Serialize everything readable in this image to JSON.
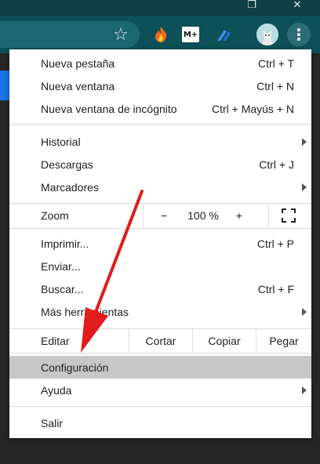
{
  "window": {
    "restore_glyph": "❐",
    "close_glyph": "✕"
  },
  "toolbar": {
    "star_glyph": "☆",
    "extensions": [
      "flame-extension",
      "movistar-plus-extension",
      "blue-arrow-extension"
    ],
    "movistar_text": "M+",
    "menu_glyph": "⋮",
    "colors": {
      "toolbar": "#0d5058",
      "titlebar": "#123f44",
      "omnibox": "#1d6770"
    }
  },
  "menu": {
    "group1": [
      {
        "label": "Nueva pestaña",
        "shortcut": "Ctrl + T"
      },
      {
        "label": "Nueva ventana",
        "shortcut": "Ctrl + N"
      },
      {
        "label": "Nueva ventana de incógnito",
        "shortcut": "Ctrl + Mayús + N"
      }
    ],
    "group2": [
      {
        "label": "Historial",
        "shortcut": "",
        "has_submenu": true
      },
      {
        "label": "Descargas",
        "shortcut": "Ctrl + J"
      },
      {
        "label": "Marcadores",
        "shortcut": "",
        "has_submenu": true
      }
    ],
    "zoom": {
      "label": "Zoom",
      "minus": "−",
      "value": "100 %",
      "plus": "+",
      "fullscreen_icon": "fullscreen-icon"
    },
    "group3": [
      {
        "label": "Imprimir...",
        "shortcut": "Ctrl + P"
      },
      {
        "label": "Enviar...",
        "shortcut": ""
      },
      {
        "label": "Buscar...",
        "shortcut": "Ctrl + F"
      },
      {
        "label": "Más herramientas",
        "shortcut": "",
        "has_submenu": true
      }
    ],
    "edit": {
      "label": "Editar",
      "cut": "Cortar",
      "copy": "Copiar",
      "paste": "Pegar"
    },
    "group4": [
      {
        "label": "Configuración",
        "highlighted": true
      },
      {
        "label": "Ayuda",
        "has_submenu": true
      }
    ],
    "group5": [
      {
        "label": "Salir"
      }
    ],
    "highlight_color": "#c7c7c7"
  },
  "annotation": {
    "arrow_color": "#e21b1b"
  }
}
